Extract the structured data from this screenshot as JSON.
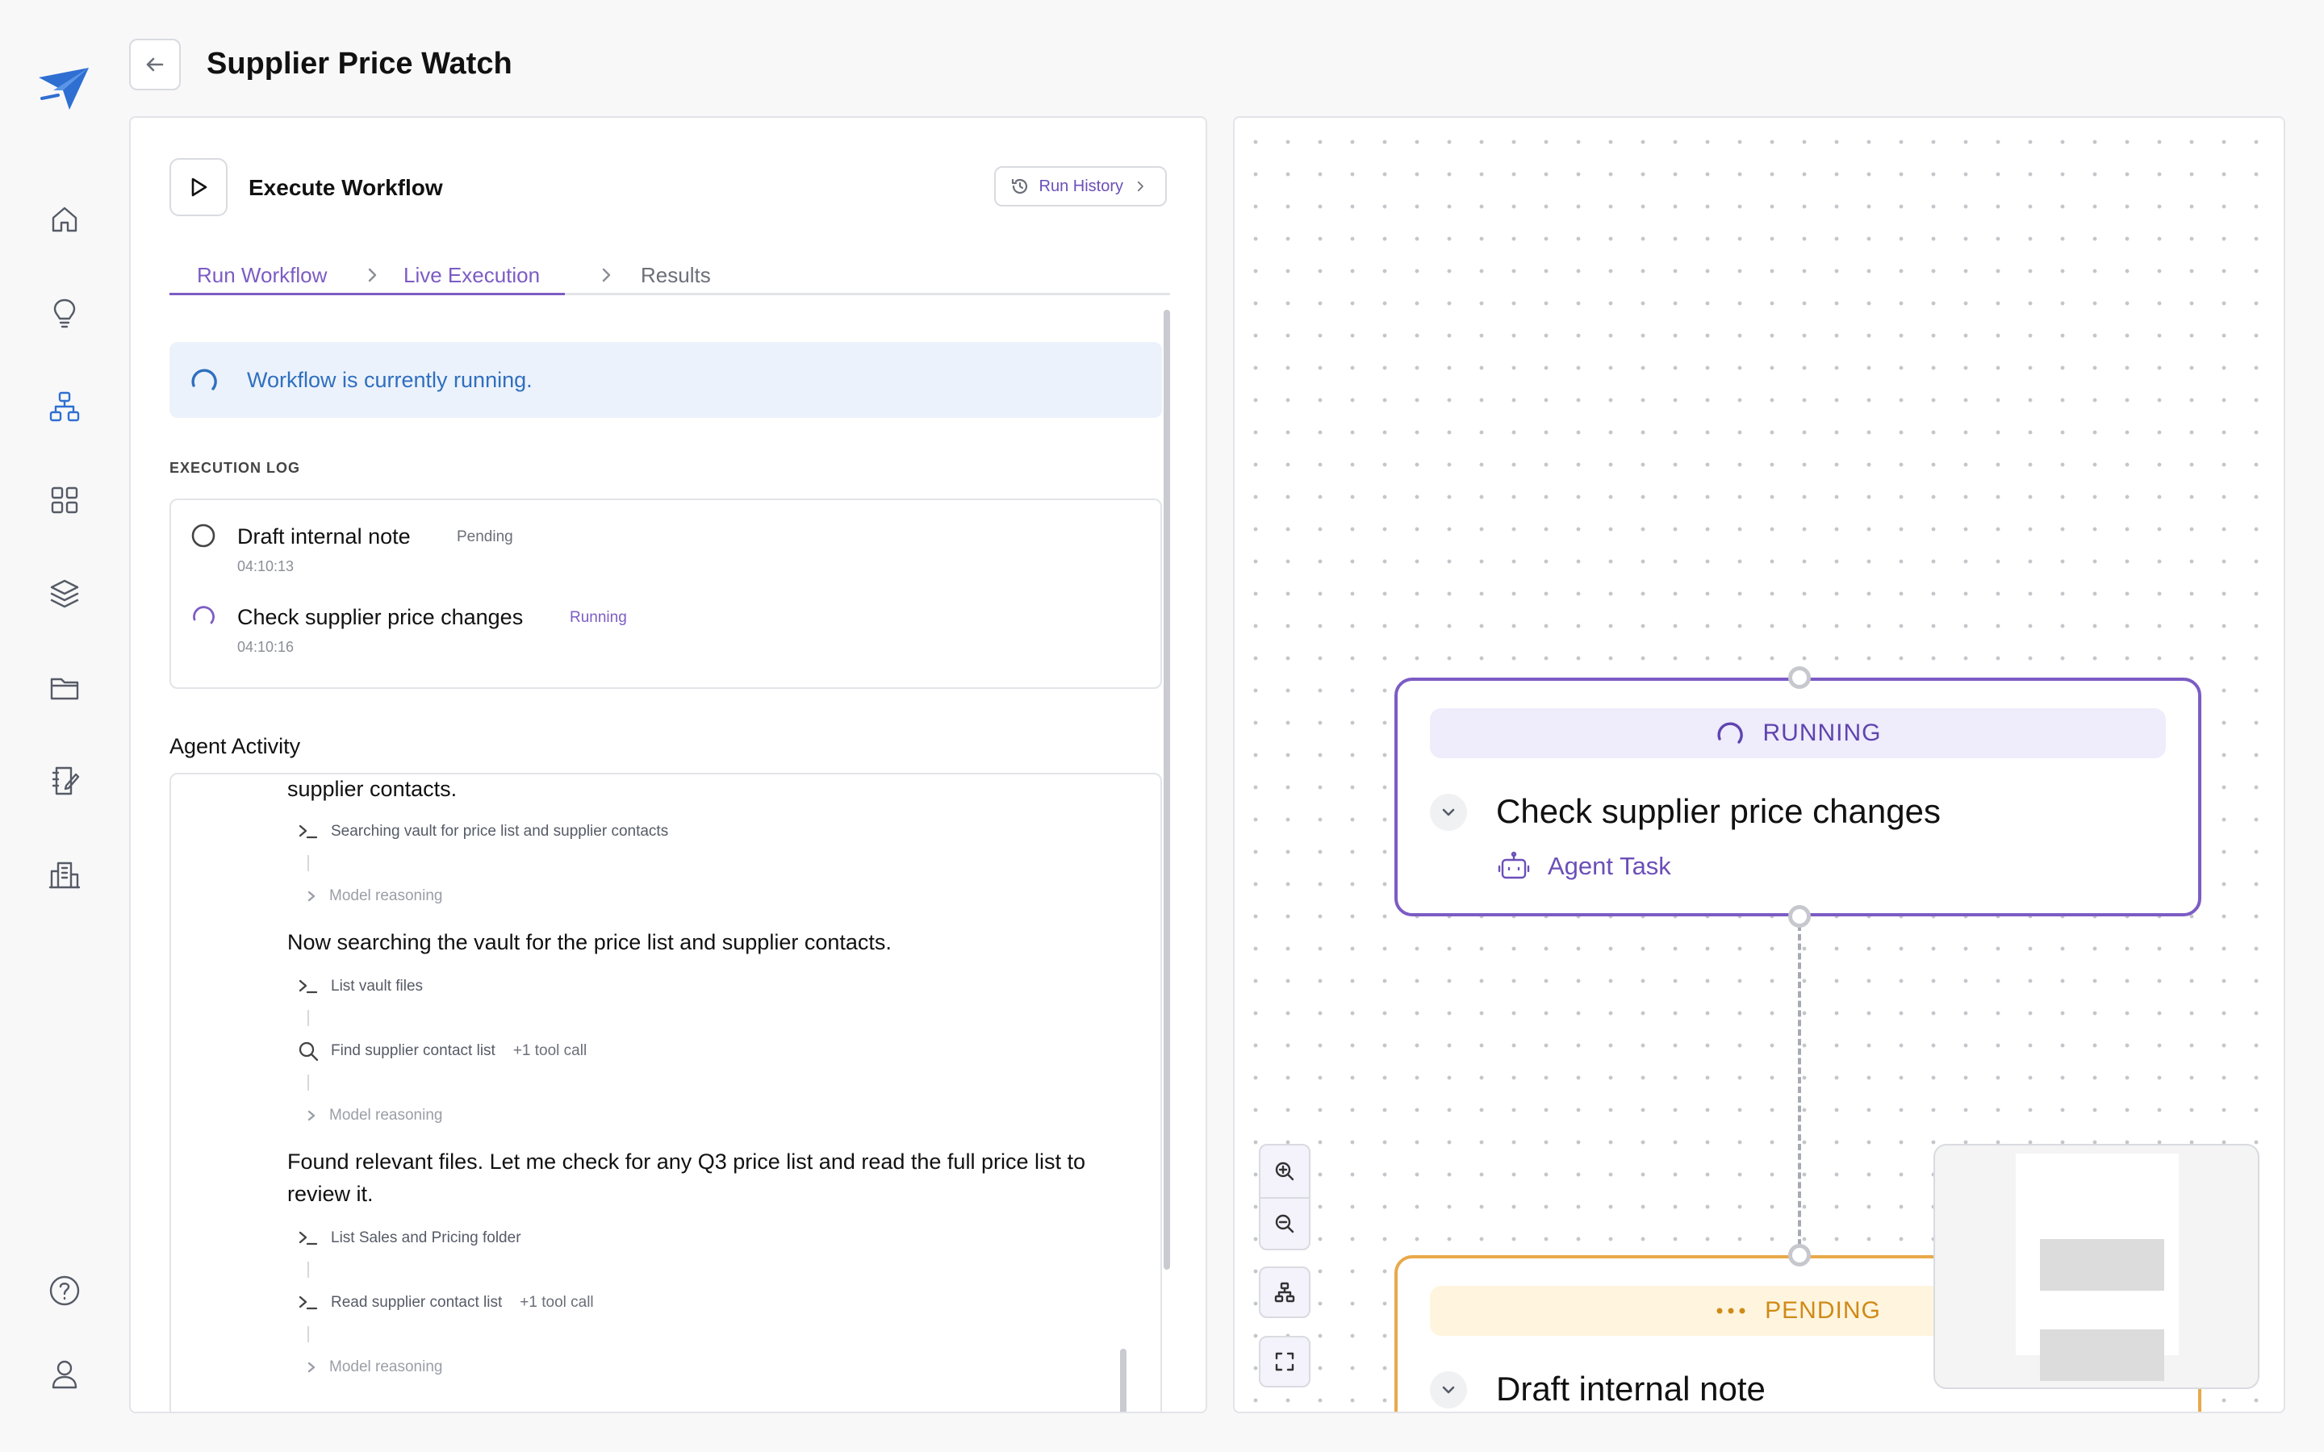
{
  "page": {
    "title": "Supplier Price Watch"
  },
  "colors": {
    "accent": "#7c5cc4",
    "running": "#5f44b0",
    "pending": "#d08a17",
    "info": "#2f6fbf"
  },
  "sidebar": {
    "logo_icon": "paper-plane-logo-icon",
    "items": [
      {
        "name": "home",
        "icon": "home-icon"
      },
      {
        "name": "ideas",
        "icon": "lightbulb-icon"
      },
      {
        "name": "workflows",
        "icon": "workflow-icon",
        "active": true
      },
      {
        "name": "apps",
        "icon": "grid-icon"
      },
      {
        "name": "layers",
        "icon": "layers-icon"
      },
      {
        "name": "files",
        "icon": "folder-icon"
      },
      {
        "name": "notes",
        "icon": "notebook-edit-icon"
      },
      {
        "name": "organization",
        "icon": "building-icon"
      }
    ],
    "bottom": [
      {
        "name": "help",
        "icon": "help-icon"
      },
      {
        "name": "profile",
        "icon": "user-icon"
      }
    ]
  },
  "panel": {
    "title": "Execute Workflow",
    "run_history_label": "Run History",
    "tabs": [
      {
        "label": "Run Workflow",
        "state": "done"
      },
      {
        "label": "Live Execution",
        "state": "active"
      },
      {
        "label": "Results",
        "state": "pending"
      }
    ],
    "banner_text": "Workflow is currently running.",
    "execution_log_label": "EXECUTION LOG",
    "execution_log": [
      {
        "name": "Draft internal note",
        "status": "Pending",
        "time": "04:10:13"
      },
      {
        "name": "Check supplier price changes",
        "status": "Running",
        "time": "04:10:16"
      }
    ],
    "agent_activity_label": "Agent Activity",
    "agent_activity": {
      "msg1": "supplier contacts.",
      "tool1": "Searching vault for price list and supplier contacts",
      "reason_label": "Model reasoning",
      "msg2": "Now searching the vault for the price list and supplier contacts.",
      "tool2": "List vault files",
      "tool3": "Find supplier contact list",
      "tool3_extra": "+1 tool call",
      "msg3": "Found relevant files. Let me check for any Q3 price list and read the full price list to review it.",
      "tool4": "List Sales and Pricing folder",
      "tool5": "Read supplier contact list",
      "tool5_extra": "+1 tool call"
    }
  },
  "canvas": {
    "nodes": [
      {
        "status": "RUNNING",
        "title": "Check supplier price changes",
        "type": "Agent Task"
      },
      {
        "status": "PENDING",
        "title": "Draft internal note"
      }
    ]
  }
}
